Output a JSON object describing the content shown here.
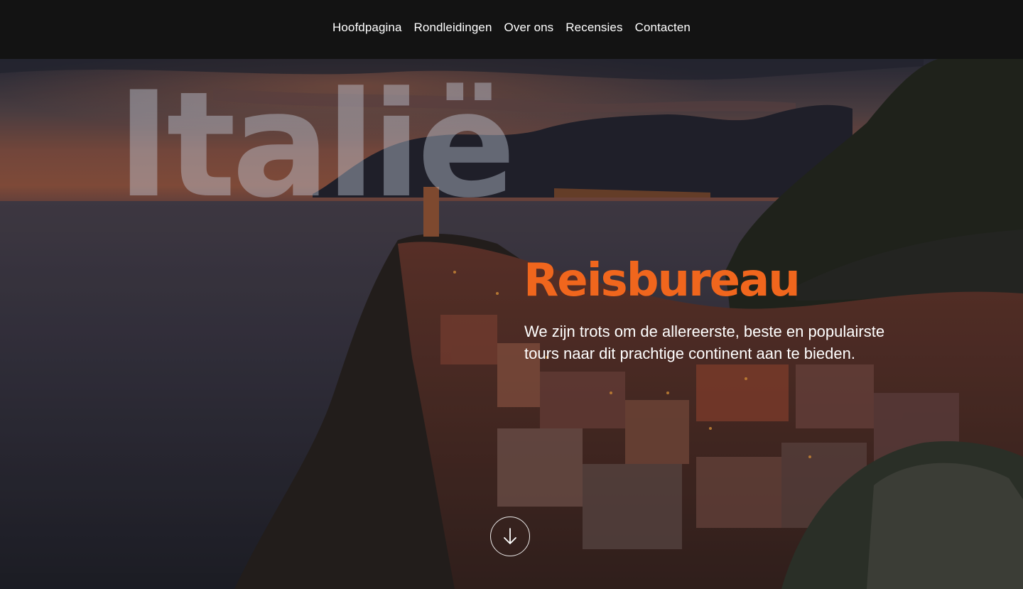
{
  "nav": {
    "items": [
      {
        "label": "Hoofdpagina"
      },
      {
        "label": "Rondleidingen"
      },
      {
        "label": "Over ons"
      },
      {
        "label": "Recensies"
      },
      {
        "label": "Contacten"
      }
    ]
  },
  "hero": {
    "watermark": "Italië",
    "title": "Reisbureau",
    "tagline": "We zijn trots om de allereerste, beste en populairste tours naar dit prachtige continent aan te bieden.",
    "scroll_icon": "arrow-down-icon"
  },
  "colors": {
    "nav_background": "#131313",
    "accent": "#f0661d",
    "text": "#ffffff"
  }
}
